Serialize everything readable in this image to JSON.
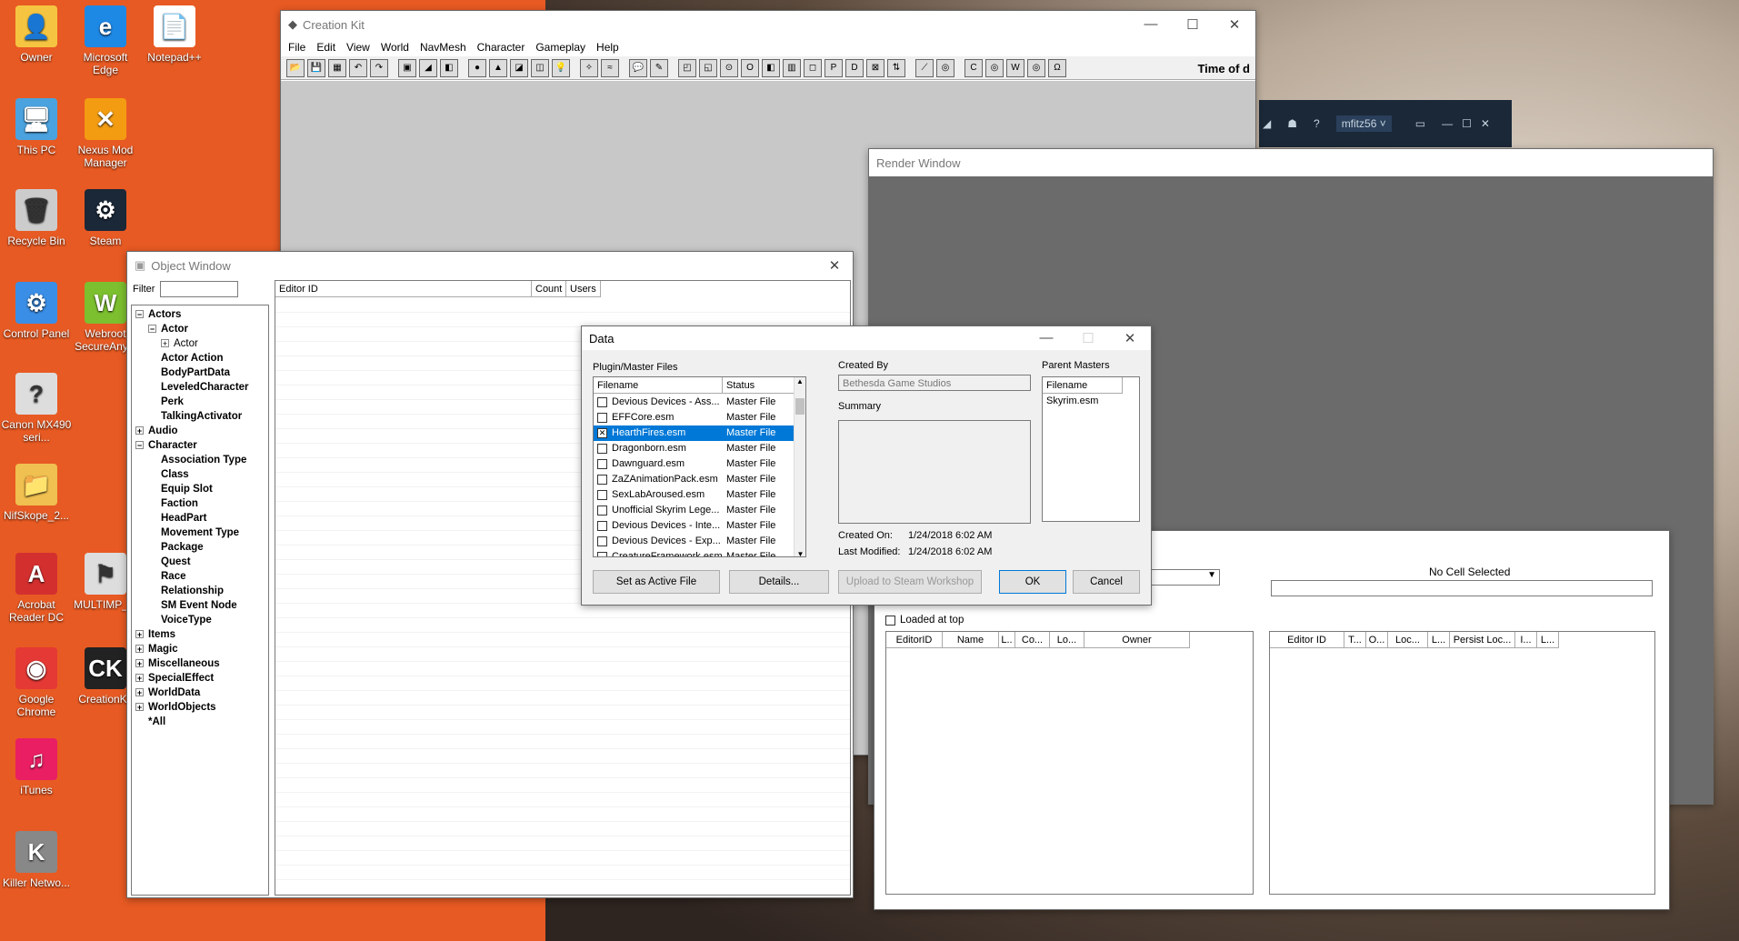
{
  "desktop": {
    "icons": [
      {
        "label": "Owner",
        "glyph": "👤",
        "color": "#f5c542"
      },
      {
        "label": "Microsoft Edge",
        "glyph": "e",
        "color": "#1e88e5"
      },
      {
        "label": "Notepad++",
        "glyph": "📄",
        "color": "#ffffff"
      },
      {
        "label": "This PC",
        "glyph": "🖥",
        "color": "#4aa3df"
      },
      {
        "label": "Nexus Mod Manager",
        "glyph": "✕",
        "color": "#f39c12"
      },
      {
        "label": "Recycle Bin",
        "glyph": "🗑",
        "color": "#cccccc"
      },
      {
        "label": "Steam",
        "glyph": "⚙",
        "color": "#1b2838"
      },
      {
        "label": "Control Panel",
        "glyph": "⚙",
        "color": "#3a8ee6"
      },
      {
        "label": "Webroot SecureAny...",
        "glyph": "W",
        "color": "#7cbf2f"
      },
      {
        "label": "Canon MX490 seri...",
        "glyph": "?",
        "color": "#dddddd"
      },
      {
        "label": "NifSkope_2...",
        "glyph": "📁",
        "color": "#f0c050"
      },
      {
        "label": "Acrobat Reader DC",
        "glyph": "A",
        "color": "#d32f2f"
      },
      {
        "label": "MULTIMP_...",
        "glyph": "⚑",
        "color": "#dddddd"
      },
      {
        "label": "Google Chrome",
        "glyph": "◉",
        "color": "#e53935"
      },
      {
        "label": "CreationKit",
        "glyph": "CK",
        "color": "#222222"
      },
      {
        "label": "iTunes",
        "glyph": "♫",
        "color": "#e91e63"
      },
      {
        "label": "Killer Netwo...",
        "glyph": "K",
        "color": "#888888"
      }
    ]
  },
  "ck": {
    "title": "Creation Kit",
    "menu": [
      "File",
      "Edit",
      "View",
      "World",
      "NavMesh",
      "Character",
      "Gameplay",
      "Help"
    ],
    "time_label": "Time of d",
    "toolbar_icons": [
      "open-icon",
      "save-icon",
      "preferences-icon",
      "undo-icon",
      "redo-icon",
      "snap-grid-icon",
      "snap-angle-icon",
      "snap-ref-icon",
      "sphere-icon",
      "landscape-icon",
      "navmesh-icon",
      "lod-icon",
      "light-icon",
      "markers-icon",
      "water-icon",
      "dialog-icon",
      "animation-icon",
      "cube-icon",
      "cube2-icon",
      "circle-icon",
      "o-icon",
      "b-icon",
      "book-icon",
      "square-icon",
      "p-icon",
      "d-icon",
      "x-icon",
      "sort-icon",
      "tool-icon",
      "render-icon",
      "c-icon",
      "c2-icon",
      "w-icon",
      "w2-icon",
      "omega-icon"
    ]
  },
  "steam_bar": {
    "user": "mfitz56 ˅",
    "help": "?"
  },
  "render_window": {
    "title": "Render Window"
  },
  "cell_view": {
    "no_cell": "No Cell Selected",
    "loaded_at_top": "Loaded at top",
    "left_cols": [
      "EditorID",
      "Name",
      "L..",
      "Co...",
      "Lo...",
      "Owner"
    ],
    "right_cols": [
      "Editor ID",
      "T...",
      "O...",
      "Loc...",
      "L...",
      "Persist Loc...",
      "I...",
      "L..."
    ]
  },
  "object_window": {
    "title": "Object Window",
    "filter_label": "Filter",
    "cols": [
      "Editor ID",
      "Count",
      "Users"
    ],
    "tree": [
      {
        "label": "Actors",
        "indent": 0,
        "exp": "−"
      },
      {
        "label": "Actor",
        "indent": 1,
        "exp": "−"
      },
      {
        "label": "Actor",
        "indent": 2,
        "exp": "+"
      },
      {
        "label": "Actor Action",
        "indent": 1,
        "exp": ""
      },
      {
        "label": "BodyPartData",
        "indent": 1,
        "exp": ""
      },
      {
        "label": "LeveledCharacter",
        "indent": 1,
        "exp": ""
      },
      {
        "label": "Perk",
        "indent": 1,
        "exp": ""
      },
      {
        "label": "TalkingActivator",
        "indent": 1,
        "exp": ""
      },
      {
        "label": "Audio",
        "indent": 0,
        "exp": "+"
      },
      {
        "label": "Character",
        "indent": 0,
        "exp": "−"
      },
      {
        "label": "Association Type",
        "indent": 1,
        "exp": ""
      },
      {
        "label": "Class",
        "indent": 1,
        "exp": ""
      },
      {
        "label": "Equip Slot",
        "indent": 1,
        "exp": ""
      },
      {
        "label": "Faction",
        "indent": 1,
        "exp": ""
      },
      {
        "label": "HeadPart",
        "indent": 1,
        "exp": ""
      },
      {
        "label": "Movement Type",
        "indent": 1,
        "exp": ""
      },
      {
        "label": "Package",
        "indent": 1,
        "exp": ""
      },
      {
        "label": "Quest",
        "indent": 1,
        "exp": ""
      },
      {
        "label": "Race",
        "indent": 1,
        "exp": ""
      },
      {
        "label": "Relationship",
        "indent": 1,
        "exp": ""
      },
      {
        "label": "SM Event Node",
        "indent": 1,
        "exp": ""
      },
      {
        "label": "VoiceType",
        "indent": 1,
        "exp": ""
      },
      {
        "label": "Items",
        "indent": 0,
        "exp": "+"
      },
      {
        "label": "Magic",
        "indent": 0,
        "exp": "+"
      },
      {
        "label": "Miscellaneous",
        "indent": 0,
        "exp": "+"
      },
      {
        "label": "SpecialEffect",
        "indent": 0,
        "exp": "+"
      },
      {
        "label": "WorldData",
        "indent": 0,
        "exp": "+"
      },
      {
        "label": "WorldObjects",
        "indent": 0,
        "exp": "+"
      },
      {
        "label": "*All",
        "indent": 0,
        "exp": ""
      }
    ]
  },
  "data_dialog": {
    "title": "Data",
    "plugin_label": "Plugin/Master Files",
    "col_filename": "Filename",
    "col_status": "Status",
    "files": [
      {
        "name": "Devious Devices - Ass...",
        "status": "Master File",
        "checked": false,
        "selected": false
      },
      {
        "name": "EFFCore.esm",
        "status": "Master File",
        "checked": false,
        "selected": false
      },
      {
        "name": "HearthFires.esm",
        "status": "Master File",
        "checked": true,
        "selected": true
      },
      {
        "name": "Dragonborn.esm",
        "status": "Master File",
        "checked": false,
        "selected": false
      },
      {
        "name": "Dawnguard.esm",
        "status": "Master File",
        "checked": false,
        "selected": false
      },
      {
        "name": "ZaZAnimationPack.esm",
        "status": "Master File",
        "checked": false,
        "selected": false
      },
      {
        "name": "SexLabAroused.esm",
        "status": "Master File",
        "checked": false,
        "selected": false
      },
      {
        "name": "Unofficial Skyrim Lege...",
        "status": "Master File",
        "checked": false,
        "selected": false
      },
      {
        "name": "Devious Devices - Inte...",
        "status": "Master File",
        "checked": false,
        "selected": false
      },
      {
        "name": "Devious Devices - Exp...",
        "status": "Master File",
        "checked": false,
        "selected": false
      },
      {
        "name": "CreatureFramework.esm",
        "status": "Master File",
        "checked": false,
        "selected": false
      }
    ],
    "created_by_label": "Created By",
    "created_by": "Bethesda Game Studios",
    "summary_label": "Summary",
    "created_on_label": "Created On:",
    "created_on": "1/24/2018  6:02 AM",
    "last_modified_label": "Last Modified:",
    "last_modified": "1/24/2018  6:02 AM",
    "parent_masters_label": "Parent Masters",
    "parent_col": "Filename",
    "parent_files": [
      "Skyrim.esm"
    ],
    "btn_active": "Set as Active File",
    "btn_details": "Details...",
    "btn_upload": "Upload to Steam Workshop",
    "btn_ok": "OK",
    "btn_cancel": "Cancel"
  }
}
